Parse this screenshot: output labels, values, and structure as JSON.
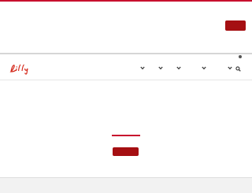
{
  "banner": {
    "button_label": ""
  },
  "navbar": {
    "logo_text": "Lilly",
    "menu_items": [
      {
        "label": "",
        "icon": "chevron-down-icon"
      },
      {
        "label": "",
        "icon": "chevron-down-icon"
      },
      {
        "label": "",
        "icon": "chevron-down-icon"
      },
      {
        "label": "",
        "icon": "chevron-down-icon"
      },
      {
        "label": "",
        "icon": "chevron-down-icon"
      }
    ],
    "search_icon": "search-icon"
  },
  "hero": {
    "button_label": ""
  },
  "colors": {
    "brand_red": "#c8102e",
    "button_red": "#a50f12",
    "logo_red": "#d52b1e",
    "divider_gray": "#d6d6d6",
    "footer_gray": "#f2f2f2"
  }
}
